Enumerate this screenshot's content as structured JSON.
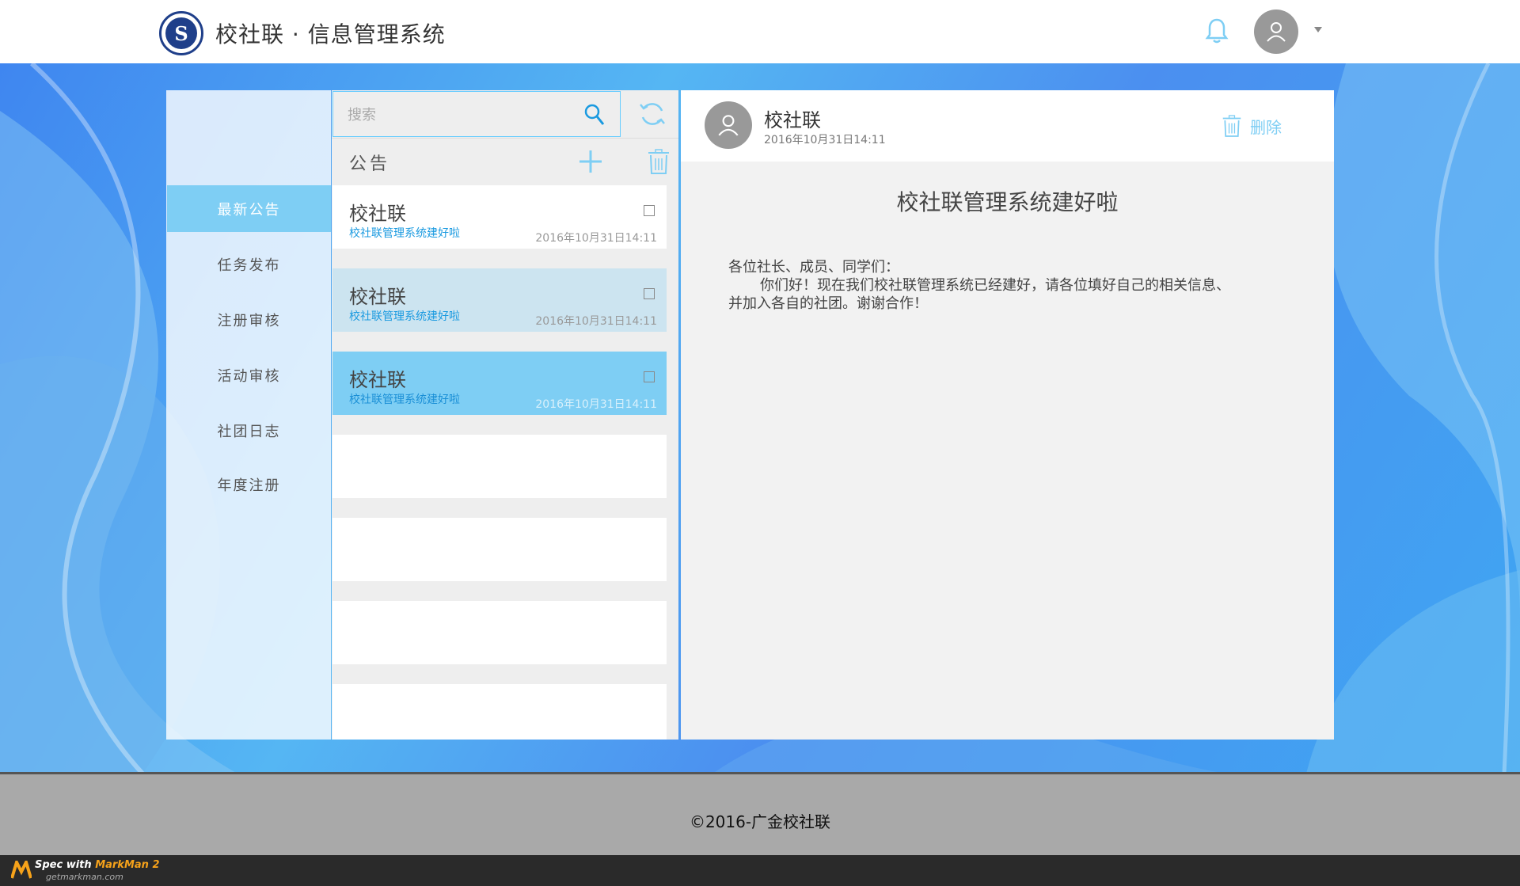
{
  "header": {
    "title": "校社联 · 信息管理系统",
    "logo_letter": "S",
    "icons": {
      "notification": "bell-icon",
      "user": "avatar-icon",
      "menu": "caret-down-icon"
    }
  },
  "sidebar": {
    "items": [
      {
        "label": "最新公告",
        "active": true
      },
      {
        "label": "任务发布",
        "active": false
      },
      {
        "label": "注册审核",
        "active": false
      },
      {
        "label": "活动审核",
        "active": false
      },
      {
        "label": "社团日志",
        "active": false
      },
      {
        "label": "年度注册",
        "active": false
      }
    ]
  },
  "search": {
    "placeholder": "搜索",
    "value": ""
  },
  "list": {
    "title": "公告",
    "items": [
      {
        "title": "校社联",
        "subtitle": "校社联管理系统建好啦",
        "time": "2016年10月31日14:11",
        "state": "normal"
      },
      {
        "title": "校社联",
        "subtitle": "校社联管理系统建好啦",
        "time": "2016年10月31日14:11",
        "state": "hover"
      },
      {
        "title": "校社联",
        "subtitle": "校社联管理系统建好啦",
        "time": "2016年10月31日14:11",
        "state": "click"
      }
    ]
  },
  "detail": {
    "author": "校社联",
    "time": "2016年10月31日14:11",
    "delete_label": "删除",
    "title": "校社联管理系统建好啦",
    "greeting": "各位社长、成员、同学们：",
    "body_line1": "你们好！现在我们校社联管理系统已经建好，请各位填好自己的相关信息、",
    "body_line2": "并加入各自的社团。谢谢合作！"
  },
  "footer": {
    "copyright": "©2016-广金校社联"
  },
  "watermark": {
    "prefix": "Spec with ",
    "brand": "MarkMan 2",
    "url": "getmarkman.com"
  },
  "colors": {
    "accent": "#7ecef4",
    "search_border": "#66ccff",
    "hover": "#cce4f0",
    "panel_bg": "#eeeeee",
    "detail_bg": "#f2f2f2",
    "scroll_thumb": "#b9b9b9",
    "scroll_track": "#f3f3f3"
  }
}
